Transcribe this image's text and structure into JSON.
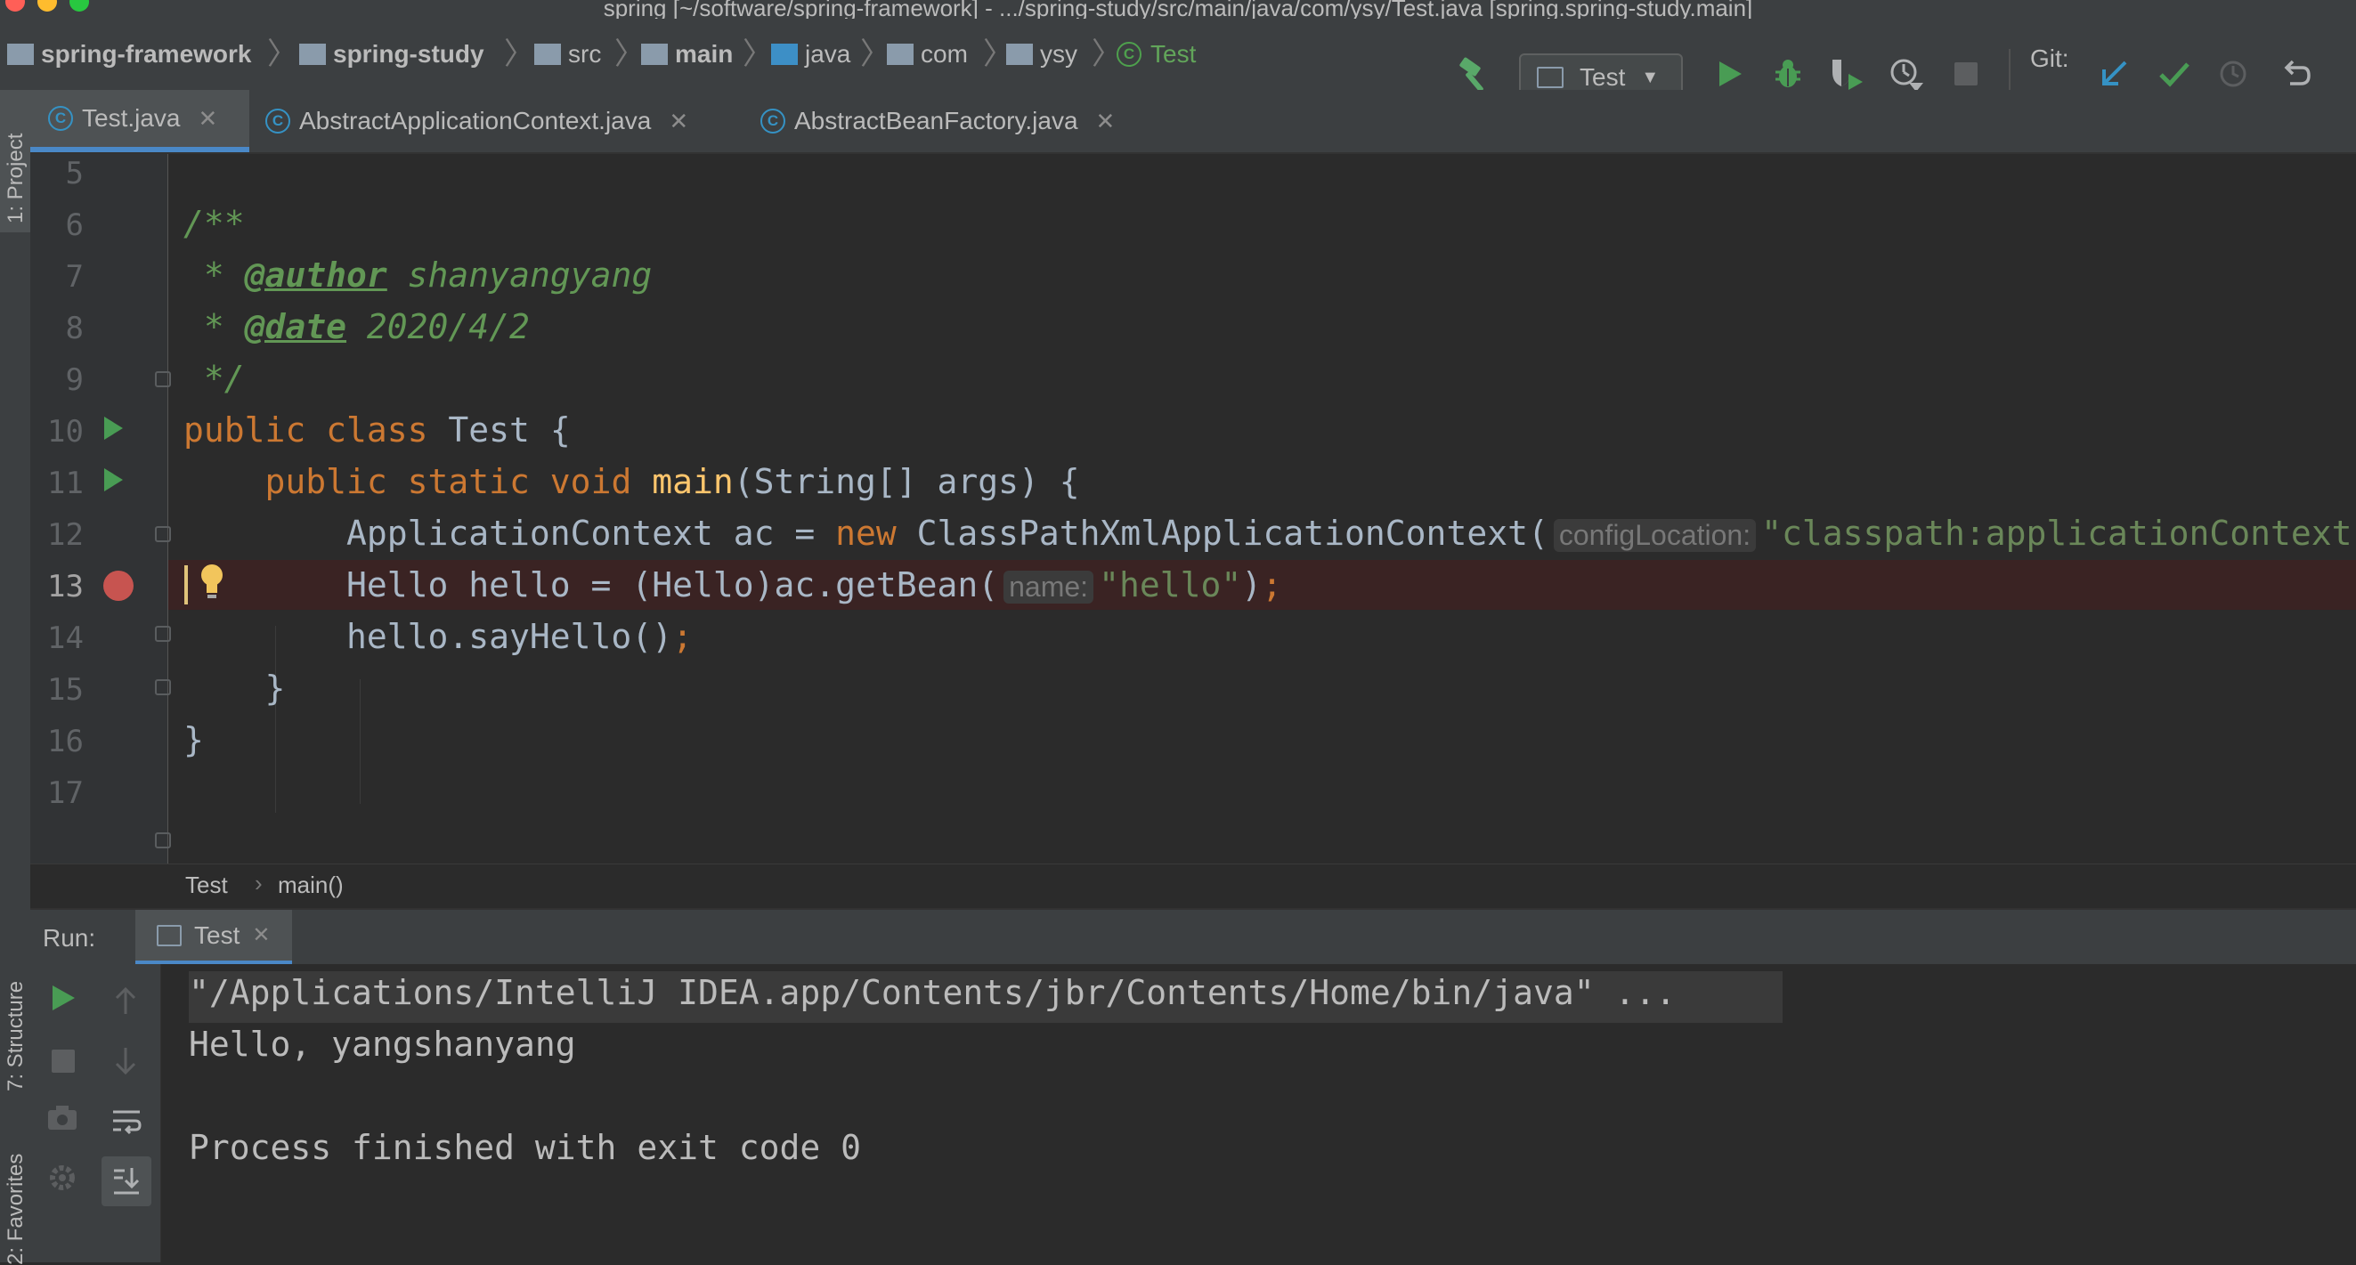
{
  "window": {
    "title": "spring [~/software/spring-framework] - .../spring-study/src/main/java/com/ysy/Test.java [spring.spring-study.main]"
  },
  "breadcrumbs": [
    {
      "label": "spring-framework",
      "icon": "module-folder-icon"
    },
    {
      "label": "spring-study",
      "icon": "module-folder-icon"
    },
    {
      "label": "src",
      "icon": "folder-icon"
    },
    {
      "label": "main",
      "icon": "source-folder-icon"
    },
    {
      "label": "java",
      "icon": "source-root-folder-icon"
    },
    {
      "label": "com",
      "icon": "package-icon"
    },
    {
      "label": "ysy",
      "icon": "package-icon"
    },
    {
      "label": "Test",
      "icon": "class-icon"
    }
  ],
  "toolbar": {
    "run_config": "Test",
    "git_label": "Git:"
  },
  "sidebar": {
    "project_label": "1: Project",
    "structure_label": "7: Structure",
    "favorites_label": "2: Favorites"
  },
  "tabs": [
    {
      "label": "Test.java",
      "active": true
    },
    {
      "label": "AbstractApplicationContext.java",
      "active": false
    },
    {
      "label": "AbstractBeanFactory.java",
      "active": false
    }
  ],
  "editor": {
    "line_numbers": [
      "5",
      "6",
      "7",
      "8",
      "9",
      "10",
      "11",
      "12",
      "13",
      "14",
      "15",
      "16",
      "17"
    ],
    "code": {
      "l6": "/**",
      "l7_star": " * ",
      "l7_tag": "@author",
      "l7_text": " shanyangyang",
      "l8_star": " * ",
      "l8_tag": "@date",
      "l8_text": " 2020/4/2",
      "l9": " */",
      "l10_kw": "public class",
      "l10_rest": " Test {",
      "l11_indent": "    ",
      "l11_kw": "public static void",
      "l11_fn": "main",
      "l11_rest": "(String[] args) {",
      "l12_a": "        ApplicationContext ac = ",
      "l12_kw": "new",
      "l12_b": " ClassPathXmlApplicationContext(",
      "l12_hint": "configLocation:",
      "l12_str": "\"classpath:applicationContext.xml\"",
      "l13_a": "        Hello hello = (Hello)ac.getBean(",
      "l13_hint": "name:",
      "l13_str": "\"hello\"",
      "l13_b": ")",
      "l13_semi": ";",
      "l14_a": "        hello.sayHello()",
      "l14_semi": ";",
      "l15": "    }",
      "l16": "}"
    },
    "breadcrumb": [
      "Test",
      "main()"
    ]
  },
  "run": {
    "label": "Run:",
    "tab": "Test",
    "console": [
      "\"/Applications/IntelliJ IDEA.app/Contents/jbr/Contents/Home/bin/java\" ...",
      "Hello, yangshanyang",
      "",
      "Process finished with exit code 0"
    ]
  },
  "colors": {
    "background": "#2b2b2b",
    "panel": "#3c3f41",
    "keyword": "#cc7832",
    "string": "#6a8759",
    "method": "#ffc66d",
    "doc": "#629755",
    "breakpoint": "#c75450",
    "run_green": "#499c54"
  }
}
